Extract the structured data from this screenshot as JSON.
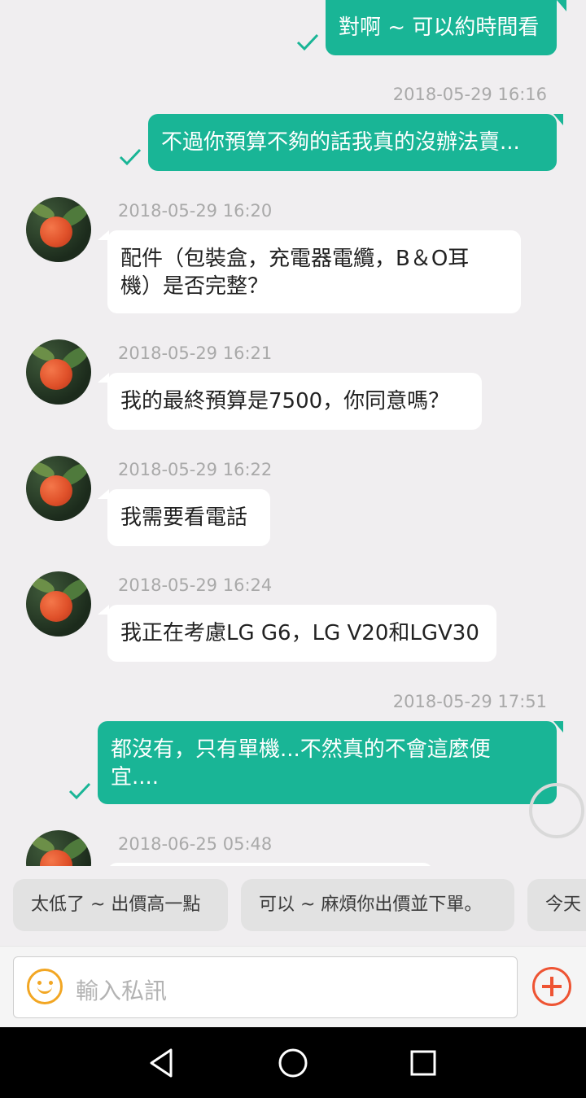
{
  "messages": [
    {
      "direction": "out",
      "time": "",
      "text": "對啊 ~ 可以約時間看",
      "read": true
    },
    {
      "direction": "out",
      "time": "2018-05-29 16:16",
      "text": "不過你預算不夠的話我真的沒辦法賣...",
      "read": true
    },
    {
      "direction": "in",
      "time": "2018-05-29 16:20",
      "text": "配件（包裝盒，充電器電纜，B＆O耳\n機）是否完整？"
    },
    {
      "direction": "in",
      "time": "2018-05-29 16:21",
      "text": "我的最終預算是7500，你同意嗎？"
    },
    {
      "direction": "in",
      "time": "2018-05-29 16:22",
      "text": "我需要看電話"
    },
    {
      "direction": "in",
      "time": "2018-05-29 16:24",
      "text": "我正在考慮LG G6，LG V20和LGV30"
    },
    {
      "direction": "out",
      "time": "2018-05-29 17:51",
      "text": "都沒有，只有單機...不然真的不會這麼便\n宜....",
      "read": true
    },
    {
      "direction": "in",
      "time": "2018-06-25 05:48",
      "text": ""
    }
  ],
  "quick_replies": [
    "太低了 ~ 出價高一點",
    "可以 ~ 麻煩你出價並下單。",
    "今天"
  ],
  "composer": {
    "placeholder": "輸入私訊",
    "emoji_icon": "smiley-icon",
    "add_icon": "plus-circle-icon"
  },
  "navigation": {
    "back": "back-triangle-icon",
    "home": "home-circle-icon",
    "recents": "recents-square-icon"
  },
  "colors": {
    "outgoing_bubble": "#19b596",
    "incoming_bubble": "#ffffff",
    "accent": "#ee5433",
    "emoji": "#f2a623"
  }
}
